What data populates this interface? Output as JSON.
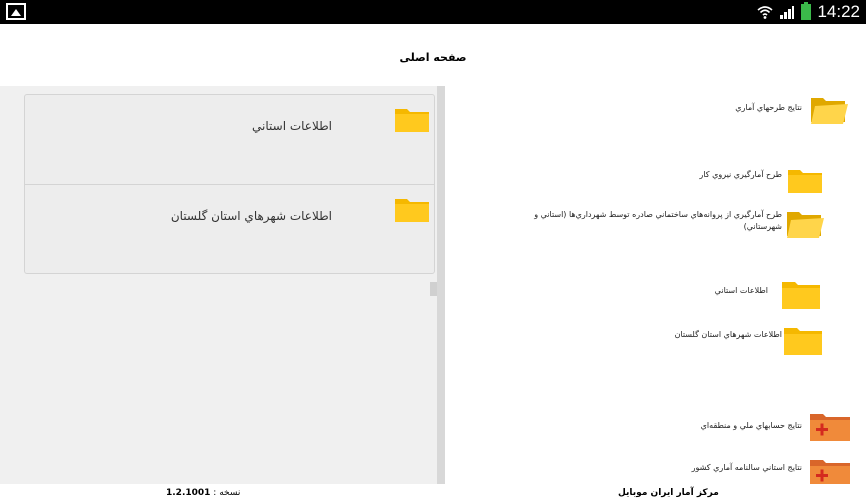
{
  "status_bar": {
    "time": "14:22",
    "icons": [
      "gallery-icon",
      "wifi-icon",
      "signal-icon",
      "battery-charging-icon"
    ],
    "battery_color": "#3bb94a"
  },
  "header": {
    "title": "صفحه اصلی"
  },
  "left_panel": {
    "items": [
      {
        "label": "اطلاعات استاني",
        "icon": "folder-icon"
      },
      {
        "label": "اطلاعات شهرهاي استان گلستان",
        "icon": "folder-icon"
      }
    ]
  },
  "tree": {
    "items": [
      {
        "label": "نتايج طرحهاي آماري",
        "icon": "folder-open-icon"
      },
      {
        "label": "طرح آمارگيري نيروي کار",
        "icon": "folder-icon"
      },
      {
        "label": "طرح آمارگيري از پروانه‌هاي ساختماني صادره توسط شهرداري‌ها (استاني و شهرستاني)",
        "icon": "folder-open-icon"
      },
      {
        "label": "اطلاعات استاني",
        "icon": "folder-icon"
      },
      {
        "label": "اطلاعات شهرهاي استان گلستان",
        "icon": "folder-icon"
      },
      {
        "label": "نتايج حسابهاي ملي و منطقه‌اي",
        "icon": "folder-plus-icon"
      },
      {
        "label": "نتايج استاني سالنامه آماري کشور",
        "icon": "folder-plus-icon"
      }
    ]
  },
  "footer": {
    "app_name": "مرکز آمار ايران موبايل",
    "version_label": "نسخه :",
    "version_value": "1.2.1001"
  },
  "colors": {
    "folder": "#f5b800",
    "folder_light": "#ffd54a",
    "folder_plus": "#e8732a",
    "plus_sign": "#d42a1f"
  }
}
